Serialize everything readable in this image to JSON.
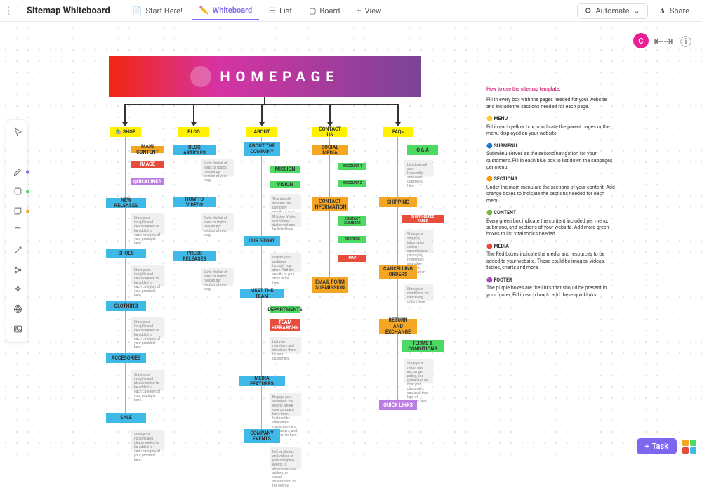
{
  "header": {
    "title": "Sitemap Whiteboard",
    "tabs": {
      "start": "Start Here!",
      "whiteboard": "Whiteboard",
      "list": "List",
      "board": "Board",
      "view": "View"
    },
    "automate": "Automate",
    "share": "Share"
  },
  "avatar": "C",
  "task_btn": "Task",
  "homepage": "HOMEPAGE",
  "menus": {
    "shop": "🛍️ SHOP",
    "blog": "BLOG",
    "about": "ABOUT",
    "contact": "CONTACT US",
    "faqs": "FAQs"
  },
  "shop": {
    "main_content": "MAIN CONTENT",
    "image": "IMAGE",
    "quicklinks": "QUICKLINKS",
    "new_releases": "NEW RELEASES",
    "new_note": "State your insights and ideas needed to be added to each category of your products here.",
    "shoes": "SHOES",
    "shoes_note": "State your insights and ideas needed to be added to each category of your products here.",
    "clothing": "CLOTHING",
    "clothing_note": "State your insights and ideas needed to be added to each category of your products here.",
    "accessories": "ACCESORIES",
    "acc_note": "State your insights and ideas needed to be added to each category of your products here.",
    "sale": "SALE",
    "sale_note": "State your insights and ideas needed to be added to each category of your products here."
  },
  "blog": {
    "articles": "BLOG ARTICLES",
    "note1": "State the list of ideas or topics needed per section of your blog.",
    "how_to": "HOW TO VIDEOS",
    "note2": "State the list of ideas or topics needed per section of your blog.",
    "press": "PRESS RELEASES",
    "note3": "State the list of ideas or topics needed per section of your blog."
  },
  "about": {
    "company": "ABOUT THE COMPANY",
    "mission": "MISSION",
    "vision": "VISION",
    "vision_note": "This should indicate the company details of your entity.",
    "mvv_note": "Mission, Vision, and Values statement can be listed here.",
    "our_story": "OUR STORY",
    "story_note": "Inspire your audience through your story. Add the details of your story in full here.",
    "meet_team": "MEET THE TEAM",
    "departments": "DEPARTMENTS",
    "hierarchy": "TEAM HIERARCHY",
    "team_note": "List your members and introduce them to your customers.",
    "media": "MEDIA FEATURES",
    "media_note": "Engage your audience: the events where your company have been featured by celebrities, media partners, influencers, and like can be here.",
    "events": "COMPANY EVENTS",
    "events_note": "Define photos and videos of your company events to showcase your culture, or visual assessment to the events."
  },
  "contact": {
    "social": "SOCIAL MEDIA",
    "acc1": "ACCOUNT 1",
    "acc2": "ACCOUNT 2",
    "info": "CONTACT INFORMATION",
    "numbers": "CONTACT NUMBERS",
    "address": "ADDRESS",
    "map": "MAP",
    "email_form": "EMAIL FORM SUBMISSION"
  },
  "faqs": {
    "qa": "Q & A",
    "qa_note": "List down all your frequently answered questions here.",
    "shipping": "SHIPPING",
    "fee_table": "SHIPPING FEE TABLE",
    "ship_note": "State your shipping information, delivery expectations, packaging references, and other relevant information here.",
    "cancel": "CANCELLING ORDERS",
    "cancel_note": "State your conditions for cancelling orders here.",
    "return": "RETURN AND EXCHANGE",
    "terms": "TERMS & CONDITIONS",
    "return_note": "State your return and exchange policy, and guidelines on how your customers can avail this type of request here.",
    "quicklinks": "QUICK LINKS"
  },
  "info": {
    "title": "How to use the sitemap template:",
    "intro": "Fill in every box with the pages needed for your website, and include the sections needed for each page.",
    "menu_h": "🟡  MENU",
    "menu_t": "Fill in each yellow box to indicate the parent pages or the menu displayed on your website.",
    "sub_h": "🔵  SUBMENU",
    "sub_t": "Submenu serves as the second navigation for your customers. Fill in each blue box to list down the subpages per menu.",
    "sec_h": "🟠  SECTIONS",
    "sec_t": "Under the main menu are the sections of your content. Add orange boxes to indicate the sections needed for each menu.",
    "con_h": "🟢  CONTENT",
    "con_t": "Every green box indicate the content included per menu, submenu, and sections of your website. Add more green boxes to list vital topics needed.",
    "med_h": "🔴  MEDIA",
    "med_t": "The Red boxes indicate the media and resources to be added to your website. These could be images, videos, tables, charts and more.",
    "foot_h": "🟣  FOOTER",
    "foot_t": "The purple boxes are the links that should be present in your footer. Fill in each box to add these quicklinks."
  }
}
